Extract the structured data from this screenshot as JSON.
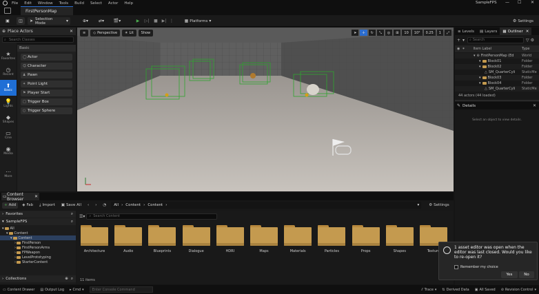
{
  "menu": {
    "items": [
      "File",
      "Edit",
      "Window",
      "Tools",
      "Build",
      "Select",
      "Actor",
      "Help"
    ],
    "project_name": "SampleFPS"
  },
  "document_tab": {
    "label": "FirstPersonMap"
  },
  "toolbar": {
    "selection_mode": "Selection Mode",
    "platforms": "Platforms",
    "settings": "Settings"
  },
  "left_categories": [
    {
      "icon": "star-icon",
      "label": "Favorites"
    },
    {
      "icon": "clock-icon",
      "label": "Recent"
    },
    {
      "icon": "basic-icon",
      "label": "Basic"
    },
    {
      "icon": "lightbulb-icon",
      "label": "Lights"
    },
    {
      "icon": "shapes-icon",
      "label": "Shapes"
    },
    {
      "icon": "cinematic-icon",
      "label": "Cine"
    },
    {
      "icon": "media-icon",
      "label": "Media"
    },
    {
      "icon": "more-icon",
      "label": "More"
    }
  ],
  "place_actors": {
    "title": "Place Actors",
    "search_placeholder": "Search Classes",
    "section": "Basic",
    "items": [
      "Actor",
      "Character",
      "Pawn",
      "Point Light",
      "Player Start",
      "Trigger Box",
      "Trigger Sphere"
    ]
  },
  "viewport": {
    "perspective": "Perspective",
    "lit": "Lit",
    "show": "Show",
    "grid_snap": "10",
    "rot_snap": "10°",
    "scale_snap": "0.25",
    "cam_speed": "1"
  },
  "outliner": {
    "tabs": [
      "Levels",
      "Layers",
      "Outliner"
    ],
    "search_placeholder": "Search",
    "col_item_label": "Item Label",
    "col_type": "Type",
    "rows": [
      {
        "label": "FirstPersonMap (Ed",
        "type": "World",
        "indent": 0,
        "folder": false
      },
      {
        "label": "Block01",
        "type": "Folder",
        "indent": 1,
        "folder": true
      },
      {
        "label": "Block02",
        "type": "Folder",
        "indent": 1,
        "folder": true
      },
      {
        "label": "SM_QuarterCyli",
        "type": "StaticMe",
        "indent": 2,
        "folder": false
      },
      {
        "label": "Block03",
        "type": "Folder",
        "indent": 1,
        "folder": true
      },
      {
        "label": "Block04",
        "type": "Folder",
        "indent": 1,
        "folder": true
      },
      {
        "label": "SM_QuarterCyli",
        "type": "StaticMe",
        "indent": 2,
        "folder": false
      }
    ],
    "actor_count": "44 actors (44 loaded)"
  },
  "details": {
    "title": "Details",
    "empty_text": "Select an object to view details."
  },
  "content_browser": {
    "tab_label": "Content Browser",
    "add": "Add",
    "fab": "Fab",
    "import": "Import",
    "save_all": "Save All",
    "breadcrumb": [
      "All",
      "Content",
      "Content"
    ],
    "settings": "Settings",
    "favorites": "Favorites",
    "project": "SampleFPS",
    "tree": [
      "All",
      "Content",
      "FirstPerson",
      "FirstPersonArms",
      "FPWeapon",
      "LevelPrototyping",
      "StarterContent"
    ],
    "collections": "Collections",
    "search_placeholder": "Search Content",
    "folders": [
      "Architecture",
      "Audio",
      "Blueprints",
      "Dialogue",
      "HDRI",
      "Maps",
      "Materials",
      "Particles",
      "Props",
      "Shapes",
      "Texture"
    ],
    "item_count": "11 items"
  },
  "statusbar": {
    "content_drawer": "Content Drawer",
    "output_log": "Output Log",
    "cmd": "Cmd",
    "console_placeholder": "Enter Console Command",
    "trace": "Trace",
    "derived_data": "Derived Data",
    "all_saved": "All Saved",
    "revision_control": "Revision Control"
  },
  "toast": {
    "message": "1 asset editor was open when the editor was last closed. Would you like to re-open it?",
    "remember": "Remember my choice",
    "yes": "Yes",
    "no": "No"
  }
}
